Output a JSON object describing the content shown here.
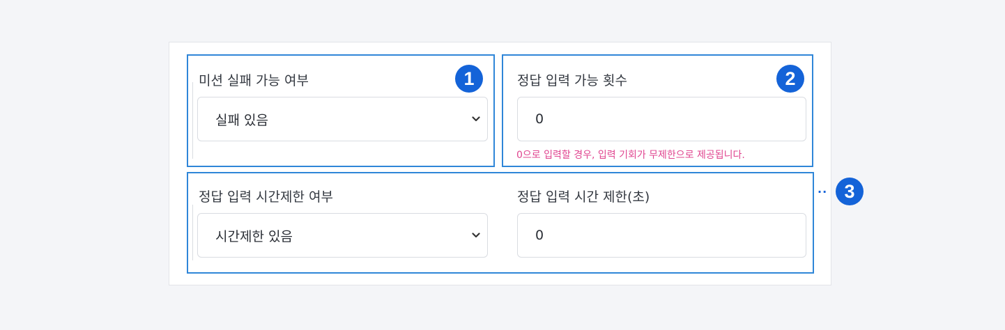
{
  "mission_fail": {
    "label": "미션 실패 가능 여부",
    "selected": "실패 있음",
    "badge": "1"
  },
  "answer_attempts": {
    "label": "정답 입력 가능 횟수",
    "value": "0",
    "hint": "0으로 입력할 경우, 입력 기회가 무제한으로 제공됩니다.",
    "badge": "2"
  },
  "time_limit_toggle": {
    "label": "정답 입력 시간제한 여부",
    "selected": "시간제한 있음"
  },
  "time_limit_seconds": {
    "label": "정답 입력 시간 제한(초)",
    "value": "0"
  },
  "group3": {
    "badge": "3",
    "connector": "··"
  },
  "colors": {
    "highlight_border": "#2f86d8",
    "badge_fill": "#1463d8",
    "hint_text": "#e0448f"
  },
  "icons": [
    "chevron-down-icon"
  ]
}
